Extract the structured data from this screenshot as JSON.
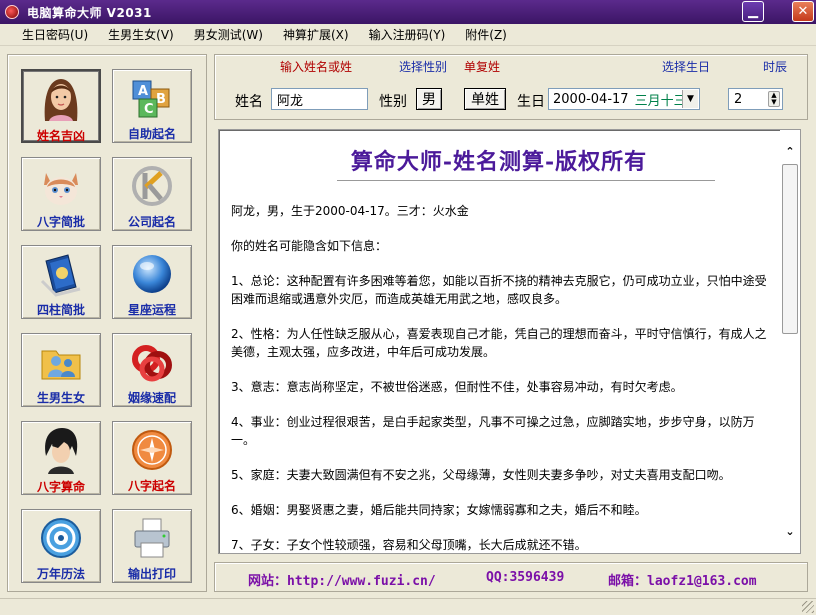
{
  "window": {
    "title": "电脑算命大师 V2031"
  },
  "menu": [
    "生日密码(U)",
    "生男生女(V)",
    "男女测试(W)",
    "神算扩展(X)",
    "输入注册码(Y)",
    "附件(Z)"
  ],
  "tiles": [
    {
      "label": "姓名吉凶",
      "icon": "girl-portrait-icon",
      "color": "#c00000"
    },
    {
      "label": "自助起名",
      "icon": "abc-blocks-icon",
      "color": "#1a2da8"
    },
    {
      "label": "八字简批",
      "icon": "kitten-icon",
      "color": "#c00000"
    },
    {
      "label": "公司起名",
      "icon": "k-logo-icon",
      "color": "#1a2da8"
    },
    {
      "label": "四柱简批",
      "icon": "book-icon",
      "color": "#1a2da8"
    },
    {
      "label": "星座运程",
      "icon": "globe-icon",
      "color": "#1a2da8"
    },
    {
      "label": "生男生女",
      "icon": "people-folder-icon",
      "color": "#1a2da8"
    },
    {
      "label": "姻缘速配",
      "icon": "rings-icon",
      "color": "#1a2da8"
    },
    {
      "label": "八字算命",
      "icon": "anime-boy-icon",
      "color": "#c00000"
    },
    {
      "label": "八字起名",
      "icon": "compass-icon",
      "color": "#c00000"
    },
    {
      "label": "万年历法",
      "icon": "disc-icon",
      "color": "#1a2da8"
    },
    {
      "label": "输出打印",
      "icon": "printer-icon",
      "color": "#1a2da8"
    }
  ],
  "form": {
    "hint_name": "输入姓名或姓",
    "hint_gender": "选择性别",
    "hint_single": "单复姓",
    "hint_birthday": "选择生日",
    "hint_hour": "时辰",
    "name_label": "姓名",
    "name_value": "阿龙",
    "gender_label": "性别",
    "gender_value": "男",
    "surname_type": "单姓",
    "birthday_label": "生日",
    "birthday_value": "2000-04-17",
    "lunar_value": "三月十三",
    "hour_value": "2"
  },
  "result": {
    "title": "算命大师-姓名测算-版权所有",
    "paragraphs": [
      "阿龙，男，生于2000-04-17。三才：火水金",
      "你的姓名可能隐含如下信息：",
      "1、总论：这种配置有许多困难等着您，如能以百折不挠的精神去克服它，仍可成功立业，只怕中途受困难而退缩或遇意外灾厄，而造成英雄无用武之地，感叹良多。",
      "2、性格：为人任性缺乏服从心，喜爱表现自己才能，凭自己的理想而奋斗，平时守信慎行，有成人之美德，主观太强，应多改进，中年后可成功发展。",
      "3、意志：意志尚称坚定，不被世俗迷惑，但耐性不佳，处事容易冲动，有时欠考虑。",
      "4、事业：创业过程很艰苦，是白手起家类型，凡事不可操之过急，应脚踏实地，步步守身，以防万一。",
      "5、家庭：夫妻大致圆满但有不安之兆，父母缘薄，女性则夫妻多争吵，对丈夫喜用支配口吻。",
      "6、婚姻：男娶贤惠之妻，婚后能共同持家；女嫁懦弱寡和之夫，婚后不和睦。",
      "7、子女：子女个性较顽强，容易和父母顶嘴，长大后成就还不错。"
    ]
  },
  "footer": {
    "website": "网站：http://www.fuzi.cn/",
    "qq": "QQ:3596439",
    "email": "邮箱：laofz1@163.com"
  }
}
